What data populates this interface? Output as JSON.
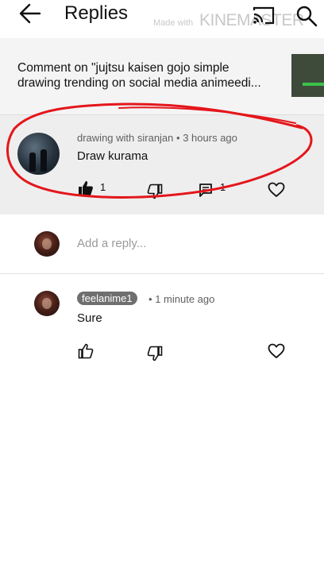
{
  "header": {
    "title": "Replies",
    "watermark_small": "Made with",
    "watermark_brand": "KINEMASTER",
    "icons": [
      "back-arrow-icon",
      "cast-icon",
      "search-icon"
    ]
  },
  "context": {
    "line1": "Comment on \"jujtsu kaisen gojo simple",
    "line2": "drawing trending on social media animeedi..."
  },
  "parent_comment": {
    "author": "drawing with siranjan",
    "separator": "•",
    "time": "3 hours ago",
    "text": "Draw kurama",
    "like_count": "1",
    "reply_count": "1",
    "liked": true
  },
  "reply_input": {
    "placeholder": "Add a reply..."
  },
  "replies": [
    {
      "author": "feelanime1",
      "separator": "•",
      "time": "1 minute ago",
      "text": "Sure"
    }
  ],
  "colors": {
    "annotation": "#e4161b",
    "author_chip": "#6f6f6f"
  }
}
